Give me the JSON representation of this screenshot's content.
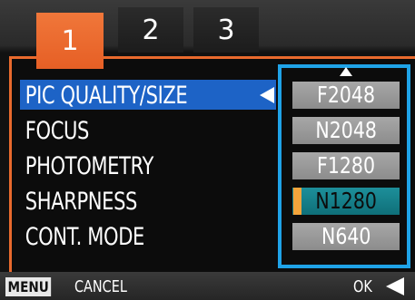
{
  "tabs": [
    {
      "label": "1",
      "active": true
    },
    {
      "label": "2",
      "active": false
    },
    {
      "label": "3",
      "active": false
    }
  ],
  "menu": {
    "items": [
      {
        "label": "PIC QUALITY/SIZE",
        "selected": true
      },
      {
        "label": "FOCUS",
        "selected": false
      },
      {
        "label": "PHOTOMETRY",
        "selected": false
      },
      {
        "label": "SHARPNESS",
        "selected": false
      },
      {
        "label": "CONT. MODE",
        "selected": false
      }
    ]
  },
  "options": {
    "items": [
      "F2048",
      "N2048",
      "F1280",
      "N1280",
      "N640"
    ],
    "highlighted": "N1280"
  },
  "footer": {
    "menu_key": "MENU",
    "cancel_label": "CANCEL",
    "ok_label": "OK"
  },
  "colors": {
    "active_tab": "#e96a2d",
    "selection_bar": "#1d63c6",
    "options_border": "#1fa3e8",
    "highlight_option": "#0f6f79"
  }
}
